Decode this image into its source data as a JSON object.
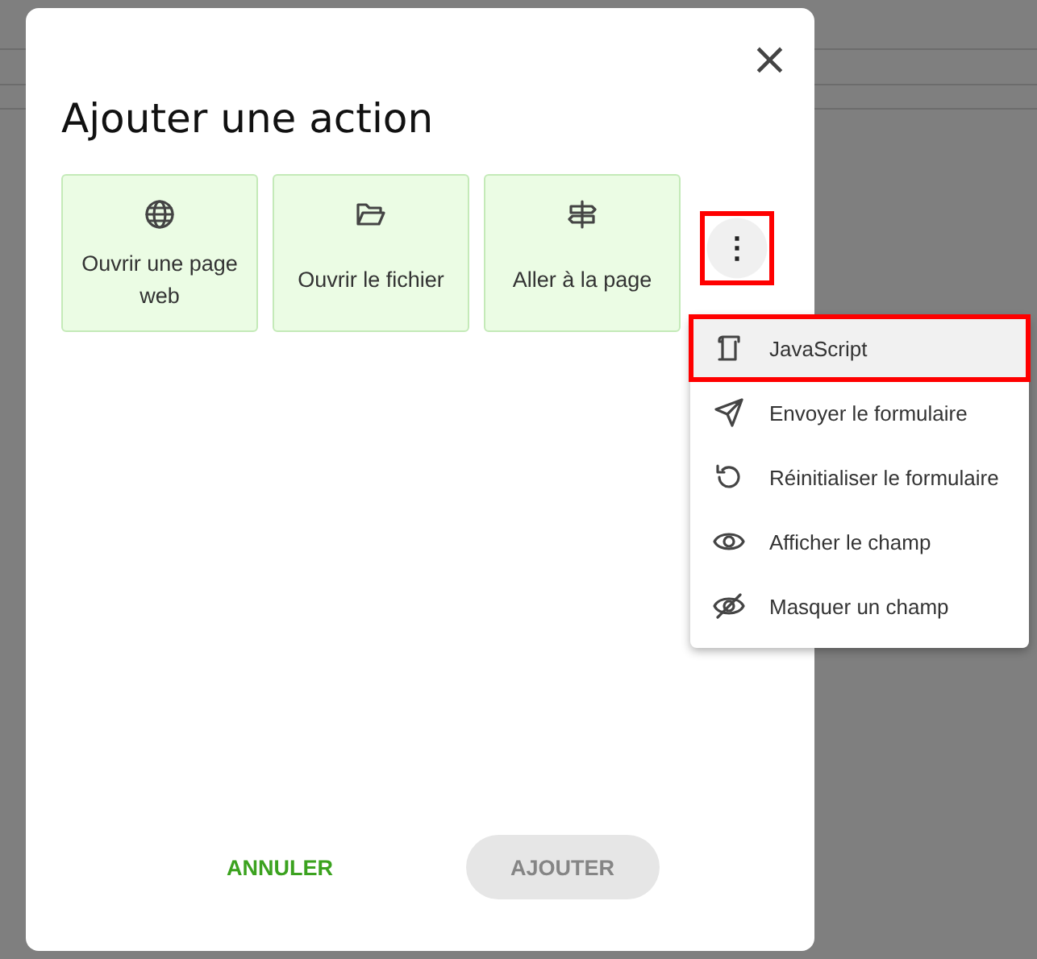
{
  "dialog": {
    "title": "Ajouter une action",
    "close_label": "×",
    "actions": [
      {
        "kind": "globe",
        "label": "Ouvrir une page web"
      },
      {
        "kind": "folder",
        "label": "Ouvrir le fichier"
      },
      {
        "kind": "signpost",
        "label": "Aller à la page"
      }
    ],
    "more_button": {
      "label": "⋮",
      "annotated": true
    },
    "buttons": [
      {
        "kind": "text",
        "label": "ANNULER",
        "disabled": false
      },
      {
        "kind": "filled",
        "label": "AJOUTER",
        "disabled": true
      }
    ]
  },
  "menu": {
    "items": [
      {
        "kind": "script",
        "label": "JavaScript",
        "highlighted": true,
        "annotated": true
      },
      {
        "kind": "send",
        "label": "Envoyer le formulaire",
        "highlighted": false,
        "annotated": false
      },
      {
        "kind": "reset",
        "label": "Réinitialiser le formulaire",
        "highlighted": false,
        "annotated": false
      },
      {
        "kind": "show",
        "label": "Afficher le champ",
        "highlighted": false,
        "annotated": false
      },
      {
        "kind": "hide",
        "label": "Masquer un champ",
        "highlighted": false,
        "annotated": false
      }
    ]
  }
}
